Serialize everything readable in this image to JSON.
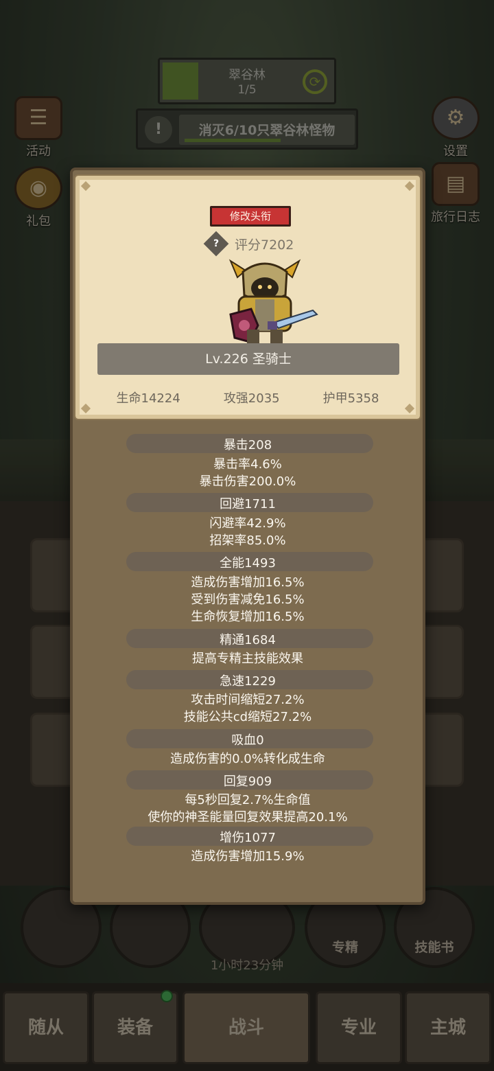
{
  "hud": {
    "stage_name": "翠谷林",
    "stage_progress": "1/5",
    "quest_text": "消灭6/10只翠谷林怪物",
    "left_buttons": [
      {
        "label": "活动",
        "icon": "scroll-icon"
      },
      {
        "label": "礼包",
        "icon": "coin-bag-icon"
      }
    ],
    "right_buttons": [
      {
        "label": "设置",
        "icon": "gear-icon"
      },
      {
        "label": "旅行日志",
        "icon": "book-icon"
      }
    ]
  },
  "profile": {
    "title_button": "修改头衔",
    "score": "评分7202",
    "level_class": "Lv.226 圣骑士",
    "base_stats": [
      "生命14224",
      "攻强2035",
      "护甲5358"
    ]
  },
  "stats": [
    {
      "name": "暴击208",
      "details": [
        "暴击率4.6%",
        "暴击伤害200.0%"
      ]
    },
    {
      "name": "回避1711",
      "details": [
        "闪避率42.9%",
        "招架率85.0%"
      ]
    },
    {
      "name": "全能1493",
      "details": [
        "造成伤害增加16.5%",
        "受到伤害减免16.5%",
        "生命恢复增加16.5%"
      ]
    },
    {
      "name": "精通1684",
      "details": [
        "提高专精主技能效果"
      ]
    },
    {
      "name": "急速1229",
      "details": [
        "攻击时间缩短27.2%",
        "技能公共cd缩短27.2%"
      ]
    },
    {
      "name": "吸血0",
      "details": [
        "造成伤害的0.0%转化成生命"
      ]
    },
    {
      "name": "回复909",
      "details": [
        "每5秒回复2.7%生命值",
        "使你的神圣能量回复效果提高20.1%"
      ]
    },
    {
      "name": "增伤1077",
      "details": [
        "造成伤害增加15.9%"
      ]
    }
  ],
  "bottom": {
    "circle_labels": [
      "专精",
      "技能书"
    ],
    "timer": "1小时23分钟",
    "tabs": [
      "随从",
      "装备",
      "战斗",
      "专业",
      "主城"
    ]
  },
  "colors": {
    "title_button_red": "#c73434",
    "stage_green": "#6f8f3b",
    "modal_brown": "#7d6b4f",
    "card_parchment": "#efe0bd"
  }
}
